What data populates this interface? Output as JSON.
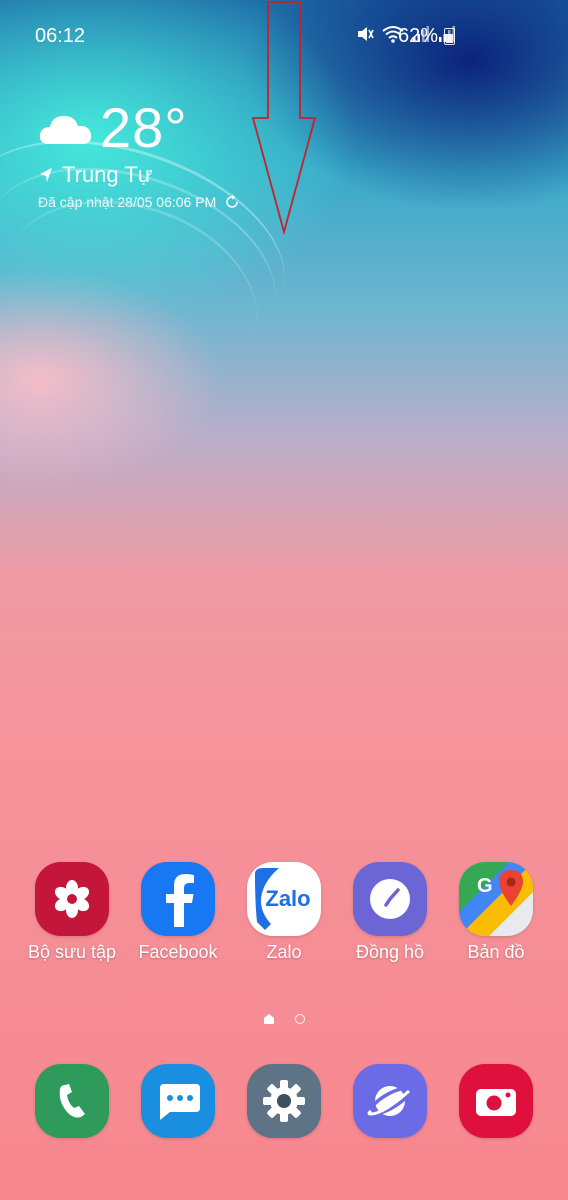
{
  "status_bar": {
    "time": "06:12",
    "battery": "62%",
    "icons": [
      "mute-icon",
      "wifi-icon",
      "signal-icon",
      "signal-icon",
      "battery-icon"
    ]
  },
  "weather": {
    "temperature": "28°",
    "location": "Trung Tự",
    "updated": "Đã cập nhật 28/05 06:06 PM",
    "icon": "cloud-icon"
  },
  "apps": [
    {
      "label": "Bộ sưu tập",
      "icon": "gallery-icon",
      "color": "#c4153a"
    },
    {
      "label": "Facebook",
      "icon": "facebook-icon",
      "color": "#1877f2"
    },
    {
      "label": "Zalo",
      "icon": "zalo-icon",
      "color": "#ffffff"
    },
    {
      "label": "Đồng hồ",
      "icon": "clock-icon",
      "color": "#6b65d6"
    },
    {
      "label": "Bản đồ",
      "icon": "maps-icon",
      "color": "#ffffff"
    }
  ],
  "dock": [
    {
      "name": "phone",
      "icon": "phone-icon",
      "color": "#2e9a5c"
    },
    {
      "name": "messages",
      "icon": "messages-icon",
      "color": "#1a8fe0"
    },
    {
      "name": "settings",
      "icon": "gear-icon",
      "color": "#5f7386"
    },
    {
      "name": "internet",
      "icon": "planet-icon",
      "color": "#6c6be6"
    },
    {
      "name": "camera",
      "icon": "camera-icon",
      "color": "#e0103e"
    }
  ],
  "page_indicator": {
    "current": 1,
    "total": 2
  },
  "annotation": {
    "color": "#c8202a"
  }
}
